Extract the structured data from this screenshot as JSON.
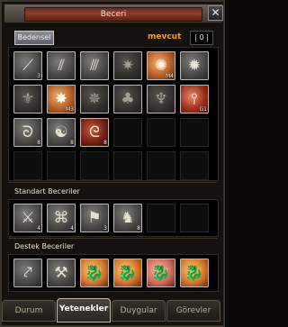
{
  "window": {
    "title": "Beceri",
    "close_glyph": "✕"
  },
  "header": {
    "category_button": "Bedensel",
    "points_label": "mevcut",
    "points_value": "| 0 |"
  },
  "skills": {
    "main": [
      {
        "icon": "sword-slash-icon",
        "glyph": "⟋",
        "style": "grey",
        "badge": "3"
      },
      {
        "icon": "blade-stripes-icon",
        "glyph": "⫽",
        "style": "grey",
        "badge": ""
      },
      {
        "icon": "twisted-blades-icon",
        "glyph": "⫻",
        "style": "grey",
        "badge": ""
      },
      {
        "icon": "spiked-star-icon",
        "glyph": "✷",
        "style": "grey-dim",
        "badge": ""
      },
      {
        "icon": "burst-star-icon",
        "glyph": "✺",
        "style": "orange",
        "badge": "M4"
      },
      {
        "icon": "gear-star-icon",
        "glyph": "✹",
        "style": "grey",
        "badge": ""
      },
      {
        "icon": "winged-figure-icon",
        "glyph": "⚜",
        "style": "grey-dim",
        "badge": ""
      },
      {
        "icon": "sun-flare-icon",
        "glyph": "✸",
        "style": "orange",
        "badge": "M3"
      },
      {
        "icon": "shuriken-icon",
        "glyph": "✵",
        "style": "grey-dim",
        "badge": ""
      },
      {
        "icon": "tree-icon",
        "glyph": "♣",
        "style": "grey-dim",
        "badge": ""
      },
      {
        "icon": "pillar-icon",
        "glyph": "♆",
        "style": "grey-dim",
        "badge": ""
      },
      {
        "icon": "fire-spear-icon",
        "glyph": "⫯",
        "style": "red",
        "badge": "G1"
      },
      {
        "icon": "swirl-icon",
        "glyph": "ᘐ",
        "style": "grey",
        "badge": "8"
      },
      {
        "icon": "yin-yang-icon",
        "glyph": "☯",
        "style": "grey",
        "badge": "8"
      },
      {
        "icon": "red-swirl-icon",
        "glyph": "ᘓ",
        "style": "red-dark",
        "badge": "8"
      }
    ],
    "standard_label": "Standart Beceriler",
    "standard": [
      {
        "icon": "sword-feather-icon",
        "glyph": "⚔",
        "style": "grey",
        "badge": "4"
      },
      {
        "icon": "knot-icon",
        "glyph": "⌘",
        "style": "grey",
        "badge": "4"
      },
      {
        "icon": "flag-icon",
        "glyph": "⚑",
        "style": "grey",
        "badge": "3"
      },
      {
        "icon": "horse-icon",
        "glyph": "♞",
        "style": "grey",
        "badge": "8"
      }
    ],
    "support_label": "Destek Beceriler",
    "support": [
      {
        "icon": "fishing-rod-icon",
        "glyph": "⤤",
        "style": "grey",
        "badge": ""
      },
      {
        "icon": "pickaxe-icon",
        "glyph": "⚒",
        "style": "grey",
        "badge": ""
      },
      {
        "icon": "dragon-icon",
        "glyph": "🐉",
        "style": "flame",
        "badge": ""
      },
      {
        "icon": "dragon-gold-icon",
        "glyph": "🐉",
        "style": "flame",
        "badge": ""
      },
      {
        "icon": "dragon-pink-icon",
        "glyph": "🐉",
        "style": "flame-pink",
        "badge": ""
      },
      {
        "icon": "dragon-orange-icon",
        "glyph": "🐉",
        "style": "flame",
        "badge": ""
      }
    ]
  },
  "tabs": [
    {
      "label": "Durum",
      "active": false
    },
    {
      "label": "Yetenekler",
      "active": true
    },
    {
      "label": "Duygular",
      "active": false
    },
    {
      "label": "Görevler",
      "active": false
    }
  ]
}
